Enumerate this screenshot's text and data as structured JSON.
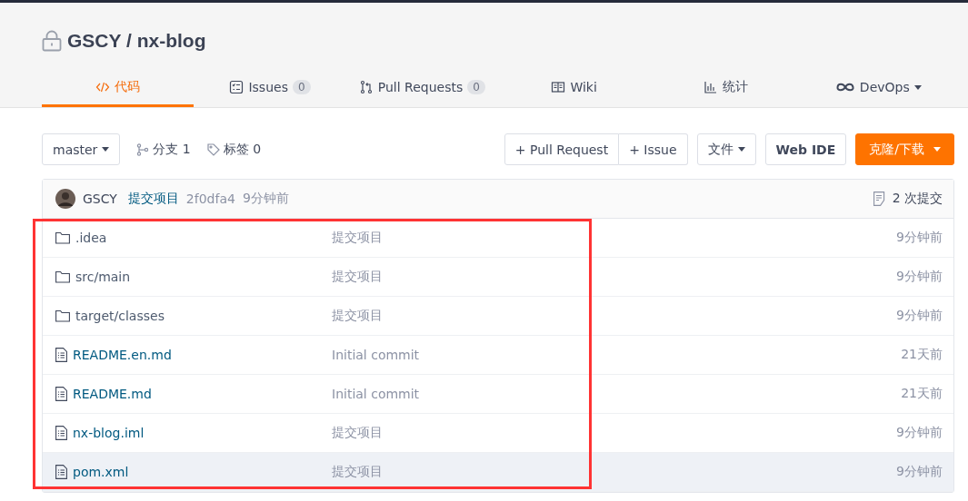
{
  "repo": {
    "owner": "GSCY",
    "separator": "/",
    "name": "nx-blog",
    "private": true
  },
  "tabs": [
    {
      "kind": "code",
      "label": "代码",
      "selected": true
    },
    {
      "kind": "issues",
      "label": "Issues",
      "count": "0",
      "selected": false
    },
    {
      "kind": "pulls",
      "label": "Pull Requests",
      "count": "0",
      "selected": false
    },
    {
      "kind": "wiki",
      "label": "Wiki",
      "selected": false
    },
    {
      "kind": "stats",
      "label": "统计",
      "selected": false
    },
    {
      "kind": "devops",
      "label": "DevOps",
      "dropdown": true,
      "selected": false
    }
  ],
  "toolbar": {
    "branch": "master",
    "branches": "分支 1",
    "tags": "标签 0",
    "new_pull_request": "+ Pull Request",
    "new_issue": "+ Issue",
    "file_menu": "文件",
    "web_ide": "Web IDE",
    "clone": "克隆/下载"
  },
  "last_commit": {
    "author": "GSCY",
    "message": "提交项目",
    "sha": "2f0dfa4",
    "time": "9分钟前",
    "commits": "2 次提交"
  },
  "files": [
    {
      "kind": "folder",
      "name": ".idea",
      "message": "提交项目",
      "time": "9分钟前",
      "highlighted": false
    },
    {
      "kind": "folder",
      "name": "src/main",
      "message": "提交项目",
      "time": "9分钟前",
      "highlighted": false
    },
    {
      "kind": "folder",
      "name": "target/classes",
      "message": "提交项目",
      "time": "9分钟前",
      "highlighted": false
    },
    {
      "kind": "file",
      "name": "README.en.md",
      "message": "Initial commit",
      "time": "21天前",
      "highlighted": false
    },
    {
      "kind": "file",
      "name": "README.md",
      "message": "Initial commit",
      "time": "21天前",
      "highlighted": false
    },
    {
      "kind": "file",
      "name": "nx-blog.iml",
      "message": "提交项目",
      "time": "9分钟前",
      "highlighted": false
    },
    {
      "kind": "file",
      "name": "pom.xml",
      "message": "提交项目",
      "time": "9分钟前",
      "highlighted": true
    }
  ],
  "annotation": {
    "kind": "rectangle",
    "color": "#ff3333"
  }
}
